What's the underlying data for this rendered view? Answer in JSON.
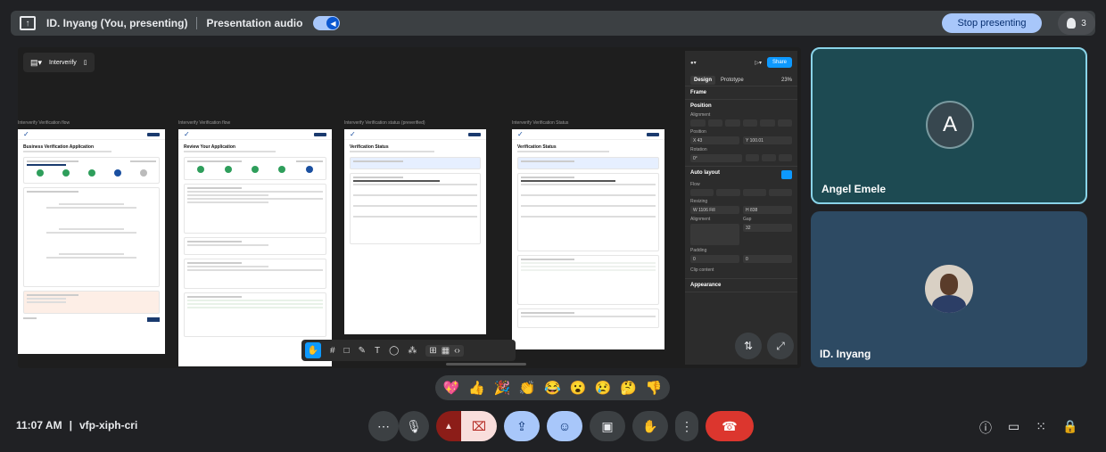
{
  "topbar": {
    "presenter_name": "ID. Inyang (You, presenting)",
    "audio_label": "Presentation audio",
    "stop_label": "Stop presenting",
    "participant_count": "3"
  },
  "figma": {
    "file_name": "Interverify",
    "frames": [
      {
        "label": "Interverify Verification flow",
        "title": "Business Verification Application"
      },
      {
        "label": "Interverify Verification flow",
        "title": "Review Your Application"
      },
      {
        "label": "Interverify Verification status (preverified)",
        "title": "Verification Status"
      },
      {
        "label": "Interverify Verification Status",
        "title": "Verification Status"
      }
    ],
    "panel": {
      "share_label": "Share",
      "tab_design": "Design",
      "tab_prototype": "Prototype",
      "zoom": "23%",
      "frame_label": "Frame",
      "position_title": "Position",
      "alignment_label": "Alignment",
      "position_label": "Position",
      "x_value": "X  43",
      "y_value": "Y  100.01",
      "rotation_label": "Rotation",
      "rotation_value": "0°",
      "autolayout_title": "Auto layout",
      "flow_label": "Flow",
      "resizing_label": "Resizing",
      "w_value": "W  1106  Fill",
      "h_value": "H  838",
      "alignment2_label": "Alignment",
      "gap_label": "Gap",
      "gap_value": "32",
      "padding_label": "Padding",
      "padding_h": "0",
      "padding_v": "0",
      "clip_label": "Clip content",
      "appearance_label": "Appearance"
    }
  },
  "tiles": [
    {
      "name": "Angel Emele",
      "initial": "A"
    },
    {
      "name": "ID. Inyang"
    }
  ],
  "reactions": [
    "💖",
    "👍",
    "🎉",
    "👏",
    "😂",
    "😮",
    "😢",
    "🤔",
    "👎"
  ],
  "meeting": {
    "time": "11:07 AM",
    "separator": "|",
    "code": "vfp-xiph-cri"
  }
}
